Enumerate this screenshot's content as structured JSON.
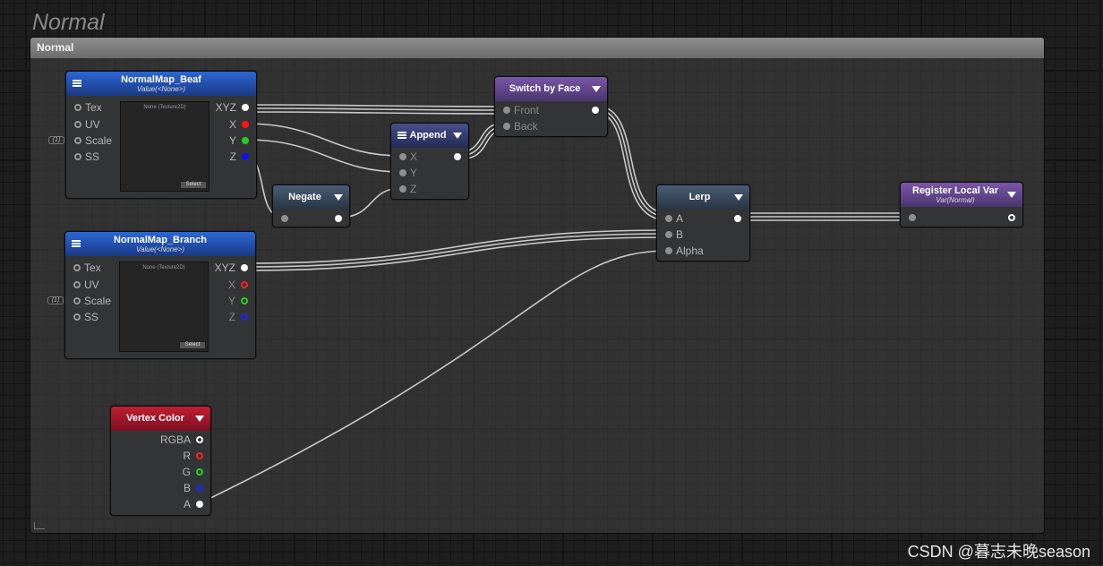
{
  "canvas": {
    "title": "Normal",
    "group_title": "Normal"
  },
  "nodes": {
    "normalmap_beaf": {
      "title": "NormalMap_Beaf",
      "subtitle": "Value(<None>)",
      "inputs": [
        "Tex",
        "UV",
        "Scale",
        "SS"
      ],
      "outputs": [
        "XYZ",
        "X",
        "Y",
        "Z"
      ],
      "texture_label": "None (Texture2D)",
      "select_label": "Select",
      "scale_badge": "(1)"
    },
    "normalmap_branch": {
      "title": "NormalMap_Branch",
      "subtitle": "Value(<None>)",
      "inputs": [
        "Tex",
        "UV",
        "Scale",
        "SS"
      ],
      "outputs": [
        "XYZ",
        "X",
        "Y",
        "Z"
      ],
      "texture_label": "None (Texture2D)",
      "select_label": "Select",
      "scale_badge": "(1)"
    },
    "negate": {
      "title": "Negate"
    },
    "append": {
      "title": "Append",
      "inputs": [
        "X",
        "Y",
        "Z"
      ]
    },
    "switch_by_face": {
      "title": "Switch by Face",
      "inputs": [
        "Front",
        "Back"
      ]
    },
    "lerp": {
      "title": "Lerp",
      "inputs": [
        "A",
        "B",
        "Alpha"
      ]
    },
    "register_local_var": {
      "title": "Register Local Var",
      "subtitle": "Var(Normal)"
    },
    "vertex_color": {
      "title": "Vertex Color",
      "outputs": [
        "RGBA",
        "R",
        "G",
        "B",
        "A"
      ]
    }
  },
  "colors": {
    "wire": "#c8c8c8",
    "port_red": "#ff1414",
    "port_green": "#20d020",
    "port_blue": "#1010ff"
  },
  "watermark": "CSDN @暮志未晚season"
}
